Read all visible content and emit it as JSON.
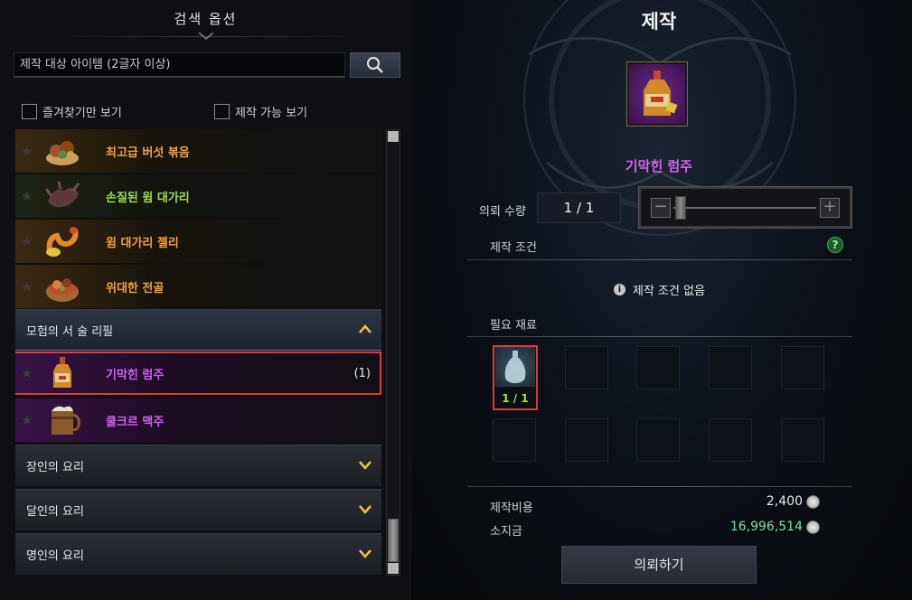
{
  "search_options": {
    "title": "검색 옵션",
    "search_placeholder": "제작 대상 아이템 (2글자 이상)",
    "favorites_only": "즐겨찾기만 보기",
    "craftable_only": "제작 가능 보기"
  },
  "recipe_list": {
    "items": [
      {
        "name": "최고급 버섯 볶음",
        "grade": "orange",
        "icon": "mushroom-dish-icon"
      },
      {
        "name": "손질된 윔 대가리",
        "grade": "green",
        "icon": "wim-head-icon"
      },
      {
        "name": "윔 대가리 젤리",
        "grade": "orange",
        "icon": "wim-jelly-icon"
      },
      {
        "name": "위대한 전골",
        "grade": "orange",
        "icon": "hotpot-icon"
      }
    ],
    "category_open": "모험의 서 술 리필",
    "sub_items": [
      {
        "name": "기막힌 럼주",
        "count": "(1)",
        "grade": "purple",
        "icon": "rum-bottle-icon"
      },
      {
        "name": "쿨크르 맥주",
        "grade": "purple",
        "icon": "beer-mug-icon"
      }
    ],
    "categories_closed": [
      "장인의 요리",
      "달인의 요리",
      "명인의 요리"
    ]
  },
  "craft": {
    "title": "제작",
    "item_name": "기막힌 럼주",
    "quantity_label": "의뢰 수량",
    "quantity_value": "1 / 1",
    "conditions_label": "제작 조건",
    "conditions_value": "제작 조건 없음",
    "materials_label": "필요 재료",
    "material_count": "1 / 1",
    "cost_label": "제작비용",
    "cost_value": "2,400",
    "gold_label": "소지금",
    "gold_value": "16,996,514",
    "request_button": "의뢰하기",
    "help_symbol": "?",
    "slider_minus": "−",
    "slider_plus": "+"
  },
  "colors": {
    "orange_grade": "#f0a23a",
    "green_grade": "#9be04a",
    "purple_grade": "#d062f0",
    "highlight_red": "#e03a3a",
    "gold_value": "#7ee0a0"
  }
}
